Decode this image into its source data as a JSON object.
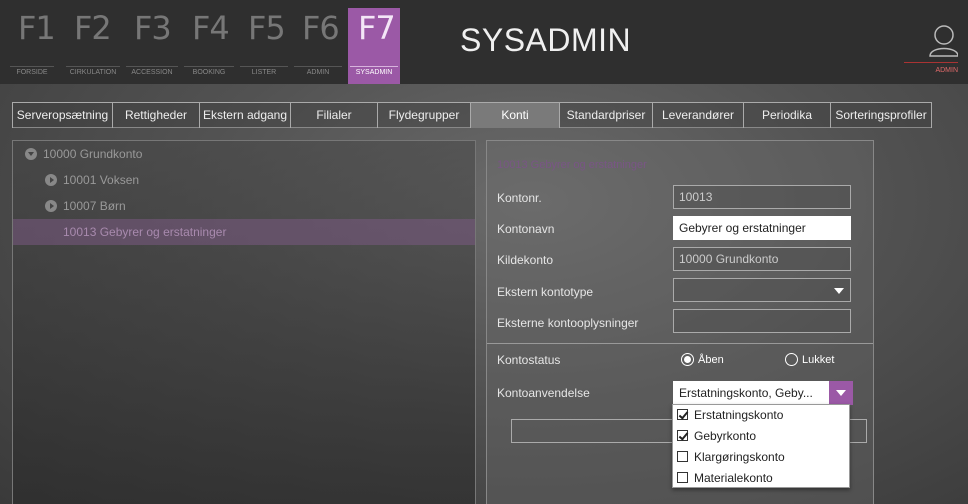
{
  "header": {
    "title": "SYSADMIN",
    "fkeys": [
      {
        "key": "F1",
        "label": "FORSIDE"
      },
      {
        "key": "F2",
        "label": "CIRKULATION"
      },
      {
        "key": "F3",
        "label": "ACCESSION"
      },
      {
        "key": "F4",
        "label": "BOOKING"
      },
      {
        "key": "F5",
        "label": "LISTER"
      },
      {
        "key": "F6",
        "label": "ADMIN"
      },
      {
        "key": "F7",
        "label": "SYSADMIN"
      }
    ],
    "user_label": "ADMIN"
  },
  "tabs": [
    {
      "label": "Serveropsætning"
    },
    {
      "label": "Rettigheder"
    },
    {
      "label": "Ekstern adgang"
    },
    {
      "label": "Filialer"
    },
    {
      "label": "Flydegrupper"
    },
    {
      "label": "Konti"
    },
    {
      "label": "Standardpriser"
    },
    {
      "label": "Leverandører"
    },
    {
      "label": "Periodika"
    },
    {
      "label": "Sorteringsprofiler"
    }
  ],
  "tree": {
    "nodes": [
      {
        "label": "10000 Grundkonto"
      },
      {
        "label": "10001 Voksen"
      },
      {
        "label": "10007 Børn"
      },
      {
        "label": "10013 Gebyrer og erstatninger"
      }
    ]
  },
  "form": {
    "title": "10013 Gebyrer og erstatninger",
    "kontonr_label": "Kontonr.",
    "kontonr_value": "10013",
    "kontonavn_label": "Kontonavn",
    "kontonavn_value": "Gebyrer og erstatninger",
    "kildekonto_label": "Kildekonto",
    "kildekonto_value": "10000 Grundkonto",
    "ekstern_type_label": "Ekstern kontotype",
    "ekstern_type_value": "",
    "ekstern_info_label": "Eksterne kontooplysninger",
    "ekstern_info_value": "",
    "status_label": "Kontostatus",
    "status_open": "Åben",
    "status_closed": "Lukket",
    "status_selected": "Åben",
    "usage_label": "Kontoanvendelse",
    "usage_value": "Erstatningskonto, Geby...",
    "usage_options": [
      {
        "label": "Erstatningskonto",
        "checked": true
      },
      {
        "label": "Gebyrkonto",
        "checked": true
      },
      {
        "label": "Klargøringskonto",
        "checked": false
      },
      {
        "label": "Materialekonto",
        "checked": false
      }
    ]
  },
  "colors": {
    "accent": "#9b59a6",
    "topbar": "#2f2f2f"
  }
}
